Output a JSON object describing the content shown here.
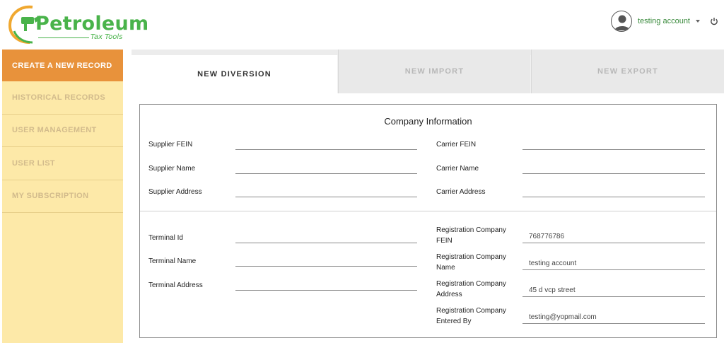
{
  "header": {
    "logo": {
      "title": "Petroleum",
      "subtitle": "Tax Tools"
    },
    "account": {
      "name": "testing account",
      "avatar_icon": "user-avatar-icon",
      "menu_icon": "chevron-down-icon",
      "logout_icon": "power-icon"
    }
  },
  "sidebar": {
    "items": [
      {
        "label": "CREATE A NEW RECORD",
        "active": true
      },
      {
        "label": "HISTORICAL RECORDS"
      },
      {
        "label": "USER MANAGEMENT"
      },
      {
        "label": "USER LIST"
      },
      {
        "label": "MY SUBSCRIPTION"
      }
    ]
  },
  "tabs": [
    {
      "label": "NEW DIVERSION",
      "active": true
    },
    {
      "label": "NEW IMPORT"
    },
    {
      "label": "NEW EXPORT"
    }
  ],
  "form": {
    "title": "Company Information",
    "supplier_fein": {
      "label": "Supplier FEIN",
      "value": ""
    },
    "supplier_name": {
      "label": "Supplier Name",
      "value": ""
    },
    "supplier_address": {
      "label": "Supplier Address",
      "value": ""
    },
    "carrier_fein": {
      "label": "Carrier FEIN",
      "value": ""
    },
    "carrier_name": {
      "label": "Carrier Name",
      "value": ""
    },
    "carrier_address": {
      "label": "Carrier Address",
      "value": ""
    },
    "terminal_id": {
      "label": "Terminal Id",
      "value": ""
    },
    "terminal_name": {
      "label": "Terminal Name",
      "value": ""
    },
    "terminal_address": {
      "label": "Terminal Address",
      "value": ""
    },
    "reg_fein": {
      "label_l1": "Registration Company",
      "label_l2": "FEIN",
      "value": "768776786"
    },
    "reg_name": {
      "label_l1": "Registration Company",
      "label_l2": "Name",
      "value": "testing account"
    },
    "reg_address": {
      "label_l1": "Registration Company",
      "label_l2": "Address",
      "value": "45 d vcp street"
    },
    "reg_entered_by": {
      "label_l1": "Registration Company",
      "label_l2": "Entered By",
      "value": "testing@yopmail.com"
    }
  }
}
